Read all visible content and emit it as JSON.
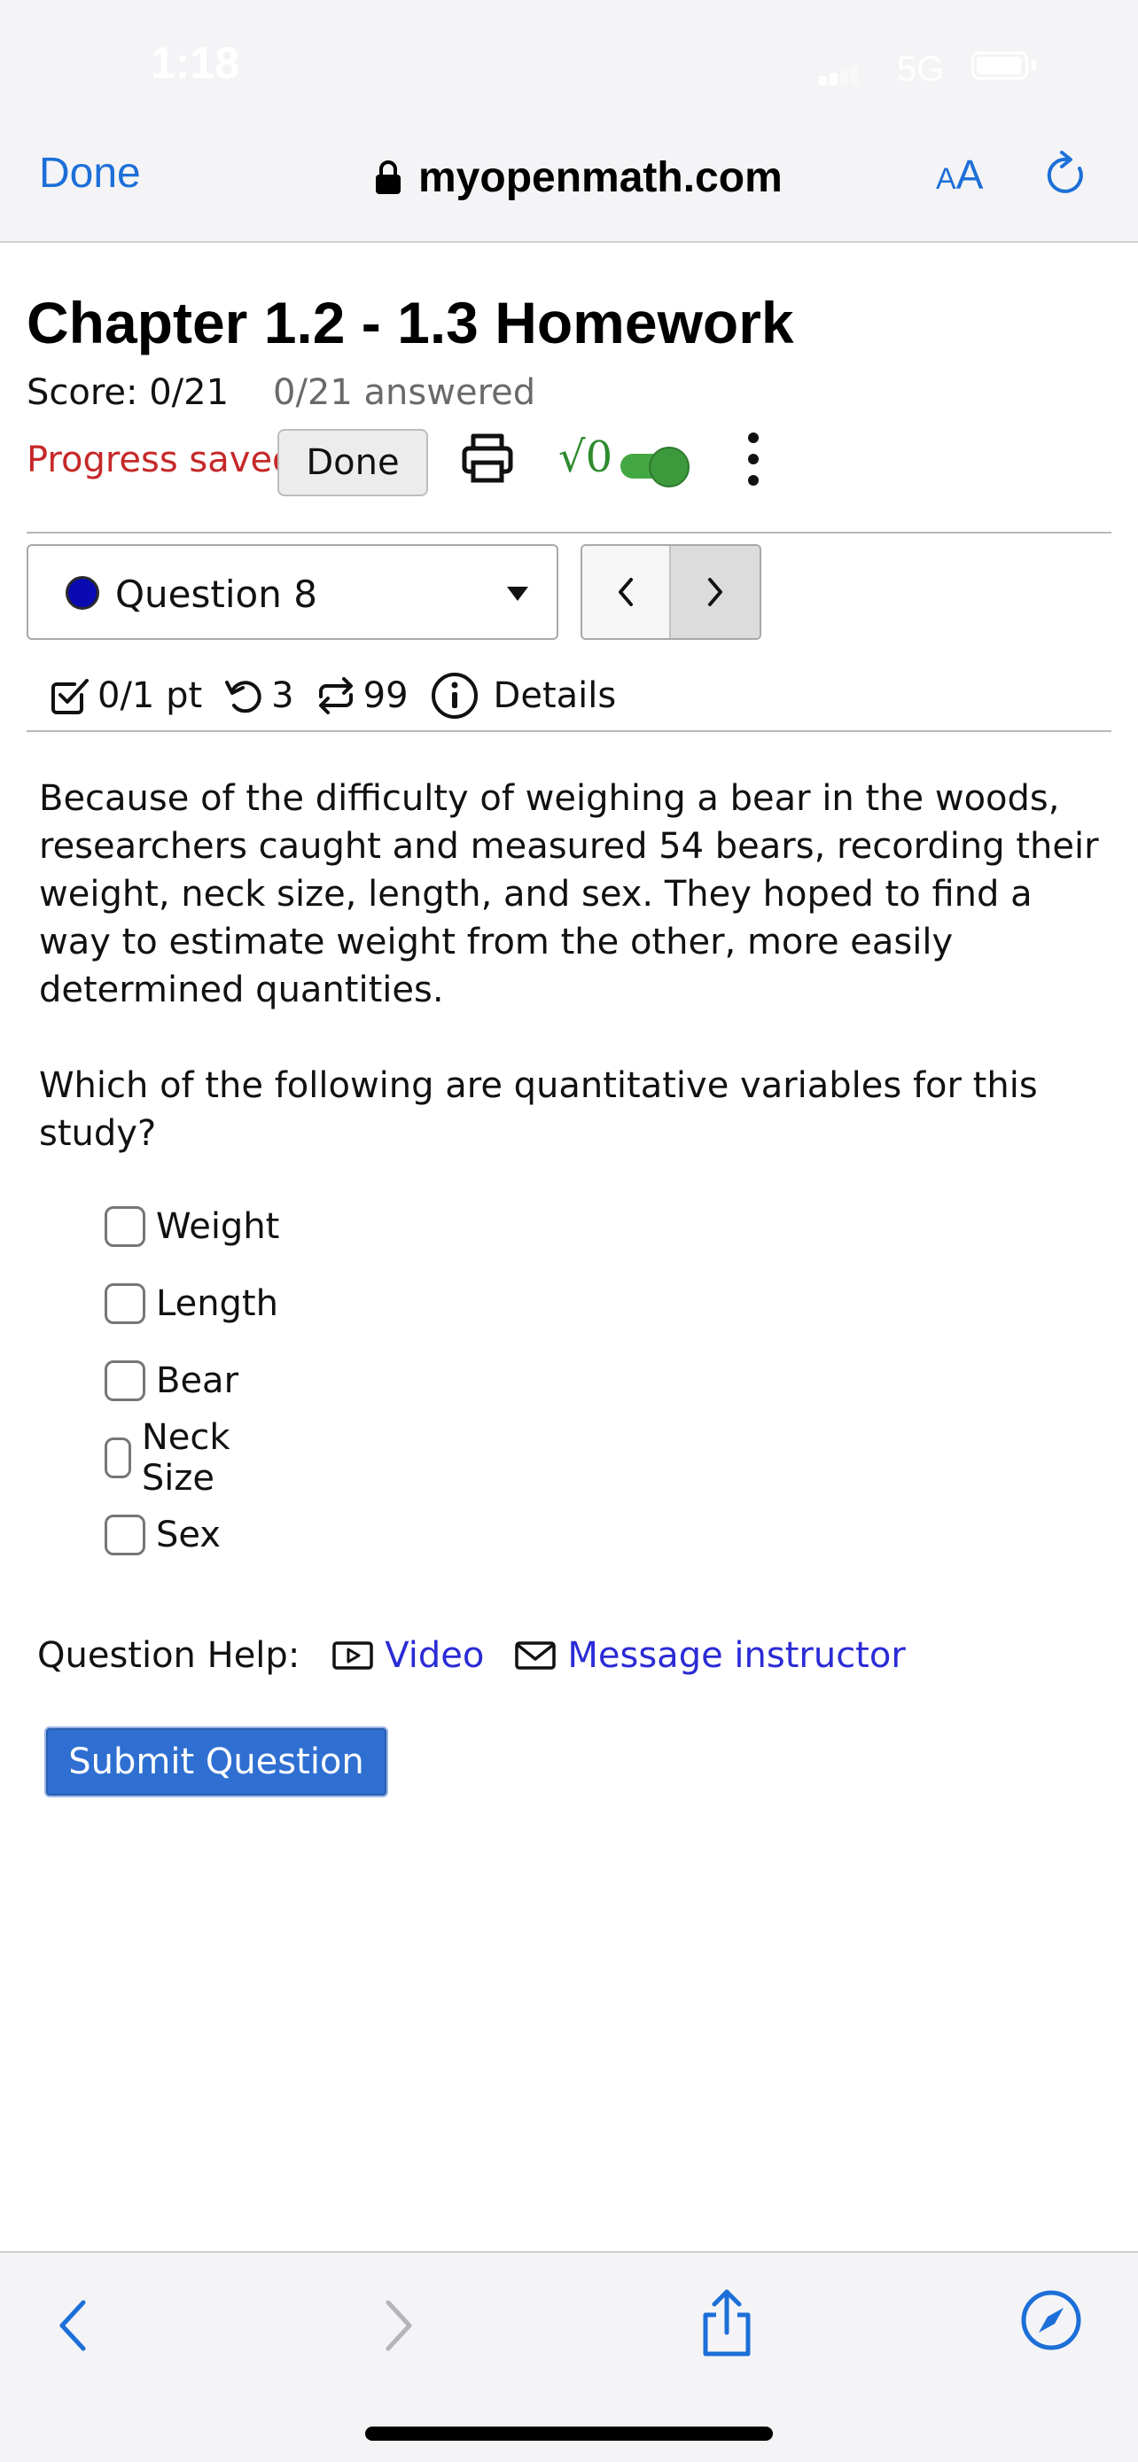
{
  "status_bar": {
    "time": "1:18",
    "network": "5G"
  },
  "browser": {
    "done_label": "Done",
    "url": "myopenmath.com",
    "text_size_small": "A",
    "text_size_big": "A"
  },
  "assignment": {
    "title": "Chapter 1.2 - 1.3 Homework",
    "score": "Score: 0/21",
    "answered": "0/21 answered",
    "progress": "Progress saved",
    "done_button": "Done",
    "math_entry_label": "√0",
    "math_entry_toggle_on": true
  },
  "question_nav": {
    "selected": "Question 8",
    "prev": "<",
    "next": ">"
  },
  "question_meta": {
    "points": "0/1 pt",
    "retries": "3",
    "versions": "99",
    "details": "Details"
  },
  "question": {
    "text": "Because of the difficulty of weighing a bear in the woods, researchers caught and measured 54 bears, recording their weight, neck size, length, and sex. They hoped to find a way to estimate weight from the other, more easily determined quantities.",
    "prompt": "Which of the following are quantitative variables for this study?",
    "options": [
      {
        "label": "Weight",
        "checked": false
      },
      {
        "label": "Length",
        "checked": false
      },
      {
        "label": "Bear",
        "checked": false
      },
      {
        "label": "Neck Size",
        "checked": false
      },
      {
        "label": "Sex",
        "checked": false
      }
    ]
  },
  "help": {
    "label": "Question Help:",
    "video": "Video",
    "message": "Message instructor"
  },
  "submit_label": "Submit Question",
  "colors": {
    "link_blue": "#1d6fd8",
    "progress_red": "#c62828",
    "toggle_green": "#43a843",
    "submit_blue": "#2f6fd1",
    "help_link": "#2b2bd6"
  }
}
